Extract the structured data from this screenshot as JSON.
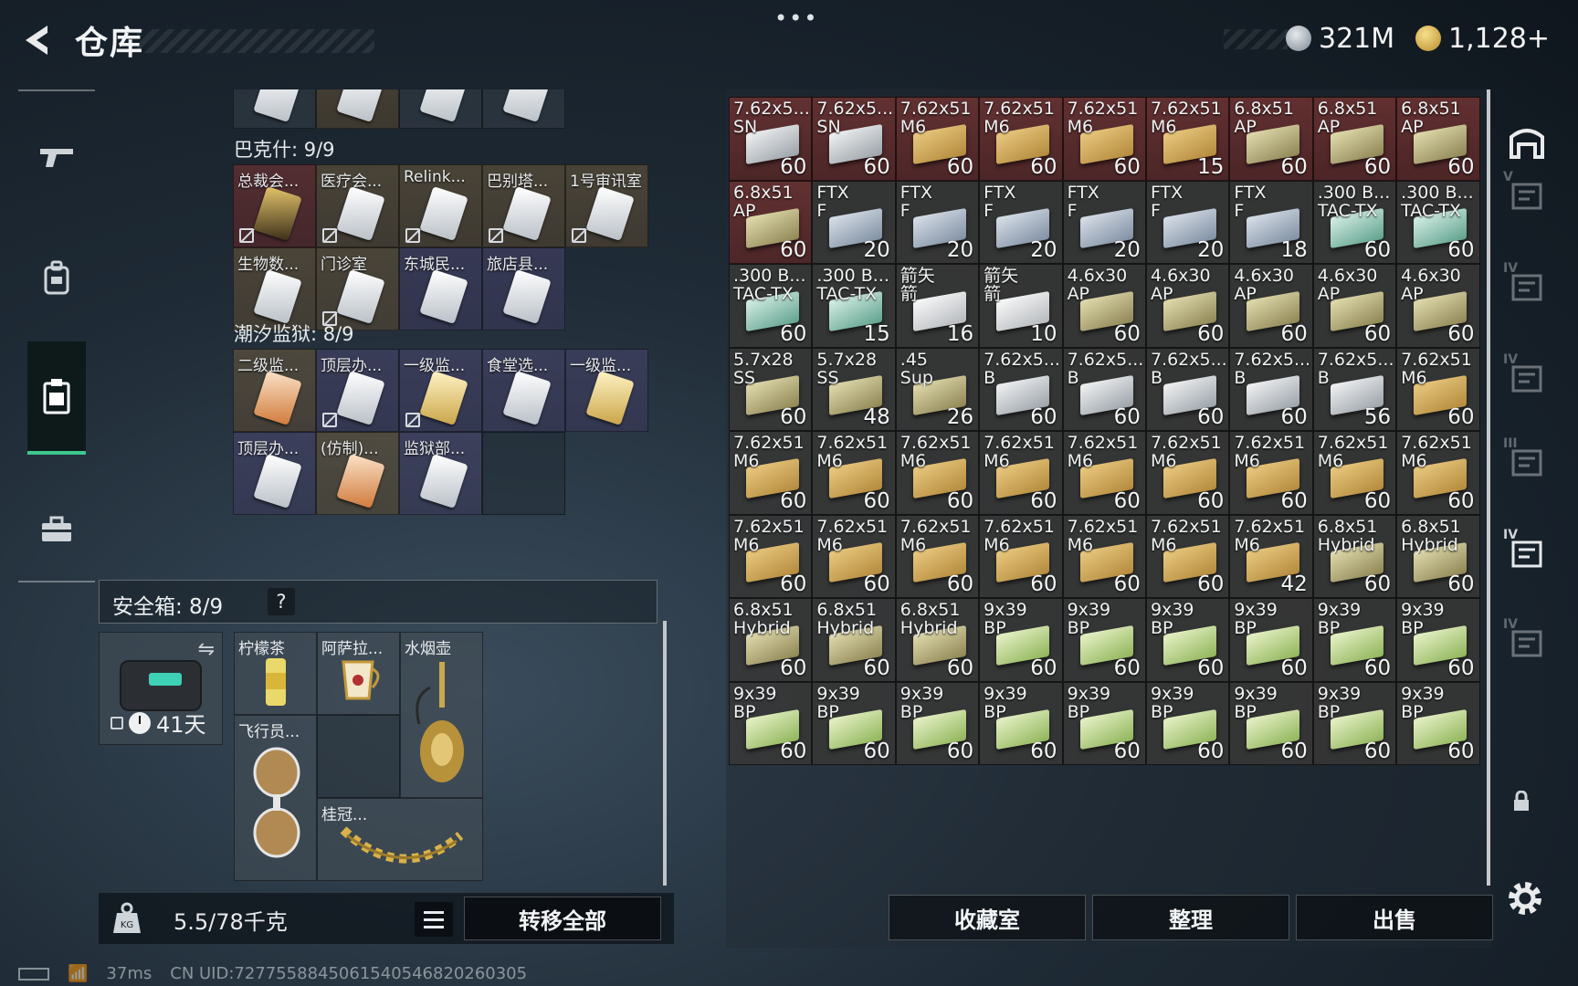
{
  "header": {
    "title": "仓库",
    "currency1": "321M",
    "currency2": "1,128+",
    "more": "•••"
  },
  "left": {
    "sections": [
      {
        "name": "巴克什: 9/9"
      },
      {
        "name": "潮汐监狱: 8/9"
      }
    ],
    "top_partial": [
      "",
      "",
      "",
      ""
    ],
    "bakesh": [
      {
        "label": "总裁会...",
        "style": "red",
        "card": "c-dark",
        "nolink": true
      },
      {
        "label": "医疗会...",
        "style": "gold",
        "card": "",
        "nolink": true
      },
      {
        "label": "Relink...",
        "style": "gold",
        "card": "",
        "nolink": true
      },
      {
        "label": "巴别塔...",
        "style": "gold",
        "card": "",
        "nolink": true
      },
      {
        "label": "1号审讯室",
        "style": "gold",
        "card": "",
        "nolink": true
      },
      {
        "label": "生物数...",
        "style": "gold",
        "card": "",
        "nolink": false
      },
      {
        "label": "门诊室",
        "style": "gold",
        "card": "",
        "nolink": true
      },
      {
        "label": "东城民...",
        "style": "purple",
        "card": "",
        "nolink": false
      },
      {
        "label": "旅店县...",
        "style": "purple",
        "card": "",
        "nolink": false
      }
    ],
    "prison": [
      {
        "label": "二级监...",
        "style": "gold",
        "card": "c-red",
        "nolink": false
      },
      {
        "label": "顶层办...",
        "style": "purple",
        "card": "",
        "nolink": true
      },
      {
        "label": "一级监...",
        "style": "purple",
        "card": "c-gold",
        "nolink": true
      },
      {
        "label": "食堂选...",
        "style": "purple",
        "card": "",
        "nolink": false
      },
      {
        "label": "一级监...",
        "style": "purple",
        "card": "c-gold",
        "nolink": false
      },
      {
        "label": "顶层办...",
        "style": "purple",
        "card": "",
        "nolink": false
      },
      {
        "label": "(仿制)...",
        "style": "gold",
        "card": "c-red",
        "nolink": false
      },
      {
        "label": "监狱部...",
        "style": "purple",
        "card": "",
        "nolink": false
      },
      {
        "label": "",
        "style": "empty",
        "card": "",
        "nolink": false
      }
    ],
    "safe": {
      "title": "安全箱: 8/9",
      "help": "?",
      "timer": "41天",
      "items": [
        {
          "label": "柠檬茶"
        },
        {
          "label": "阿萨拉..."
        },
        {
          "label": "水烟壶"
        },
        {
          "label": "飞行员..."
        },
        {
          "label": "桂冠..."
        }
      ]
    },
    "weight": "5.5/78千克",
    "transfer_label": "转移全部"
  },
  "ammo": [
    {
      "l": "7.62x5...\nSN",
      "c": "60",
      "s": "red",
      "b": "white"
    },
    {
      "l": "7.62x5...\nSN",
      "c": "60",
      "s": "red",
      "b": "white"
    },
    {
      "l": "7.62x51\nM6",
      "c": "60",
      "s": "red",
      "b": "tan"
    },
    {
      "l": "7.62x51\nM6",
      "c": "60",
      "s": "red",
      "b": "tan"
    },
    {
      "l": "7.62x51\nM6",
      "c": "60",
      "s": "red",
      "b": "tan"
    },
    {
      "l": "7.62x51\nM6",
      "c": "15",
      "s": "red",
      "b": "tan"
    },
    {
      "l": "6.8x51\nAP",
      "c": "60",
      "s": "red",
      "b": "olive"
    },
    {
      "l": "6.8x51\nAP",
      "c": "60",
      "s": "red",
      "b": "olive"
    },
    {
      "l": "6.8x51\nAP",
      "c": "60",
      "s": "red",
      "b": "olive"
    },
    {
      "l": "6.8x51\nAP",
      "c": "60",
      "s": "red",
      "b": "olive"
    },
    {
      "l": "FTX\nF",
      "c": "20",
      "s": "",
      "b": "steel"
    },
    {
      "l": "FTX\nF",
      "c": "20",
      "s": "",
      "b": "steel"
    },
    {
      "l": "FTX\nF",
      "c": "20",
      "s": "",
      "b": "steel"
    },
    {
      "l": "FTX\nF",
      "c": "20",
      "s": "",
      "b": "steel"
    },
    {
      "l": "FTX\nF",
      "c": "20",
      "s": "",
      "b": "steel"
    },
    {
      "l": "FTX\nF",
      "c": "18",
      "s": "",
      "b": "steel"
    },
    {
      "l": ".300 B...\nTAC-TX",
      "c": "60",
      "s": "",
      "b": "teal"
    },
    {
      "l": ".300 B...\nTAC-TX",
      "c": "60",
      "s": "",
      "b": "teal"
    },
    {
      "l": ".300 B...\nTAC-TX",
      "c": "60",
      "s": "",
      "b": "teal"
    },
    {
      "l": ".300 B...\nTAC-TX",
      "c": "15",
      "s": "",
      "b": "teal"
    },
    {
      "l": "箭矢\n箭",
      "c": "16",
      "s": "",
      "b": "silver"
    },
    {
      "l": "箭矢\n箭",
      "c": "10",
      "s": "",
      "b": "silver"
    },
    {
      "l": "4.6x30\nAP",
      "c": "60",
      "s": "",
      "b": "olive"
    },
    {
      "l": "4.6x30\nAP",
      "c": "60",
      "s": "",
      "b": "olive"
    },
    {
      "l": "4.6x30\nAP",
      "c": "60",
      "s": "",
      "b": "olive"
    },
    {
      "l": "4.6x30\nAP",
      "c": "60",
      "s": "",
      "b": "olive"
    },
    {
      "l": "4.6x30\nAP",
      "c": "60",
      "s": "",
      "b": "olive"
    },
    {
      "l": "5.7x28\nSS",
      "c": "60",
      "s": "",
      "b": "olive"
    },
    {
      "l": "5.7x28\nSS",
      "c": "48",
      "s": "",
      "b": "olive"
    },
    {
      "l": ".45\nSup",
      "c": "26",
      "s": "",
      "b": "olive"
    },
    {
      "l": "7.62x5...\nB",
      "c": "60",
      "s": "",
      "b": "white"
    },
    {
      "l": "7.62x5...\nB",
      "c": "60",
      "s": "",
      "b": "white"
    },
    {
      "l": "7.62x5...\nB",
      "c": "60",
      "s": "",
      "b": "white"
    },
    {
      "l": "7.62x5...\nB",
      "c": "60",
      "s": "",
      "b": "white"
    },
    {
      "l": "7.62x5...\nB",
      "c": "56",
      "s": "",
      "b": "white"
    },
    {
      "l": "7.62x51\nM6",
      "c": "60",
      "s": "",
      "b": "tan"
    },
    {
      "l": "7.62x51\nM6",
      "c": "60",
      "s": "",
      "b": "tan"
    },
    {
      "l": "7.62x51\nM6",
      "c": "60",
      "s": "",
      "b": "tan"
    },
    {
      "l": "7.62x51\nM6",
      "c": "60",
      "s": "",
      "b": "tan"
    },
    {
      "l": "7.62x51\nM6",
      "c": "60",
      "s": "",
      "b": "tan"
    },
    {
      "l": "7.62x51\nM6",
      "c": "60",
      "s": "",
      "b": "tan"
    },
    {
      "l": "7.62x51\nM6",
      "c": "60",
      "s": "",
      "b": "tan"
    },
    {
      "l": "7.62x51\nM6",
      "c": "60",
      "s": "",
      "b": "tan"
    },
    {
      "l": "7.62x51\nM6",
      "c": "60",
      "s": "",
      "b": "tan"
    },
    {
      "l": "7.62x51\nM6",
      "c": "60",
      "s": "",
      "b": "tan"
    },
    {
      "l": "7.62x51\nM6",
      "c": "60",
      "s": "",
      "b": "tan"
    },
    {
      "l": "7.62x51\nM6",
      "c": "60",
      "s": "",
      "b": "tan"
    },
    {
      "l": "7.62x51\nM6",
      "c": "60",
      "s": "",
      "b": "tan"
    },
    {
      "l": "7.62x51\nM6",
      "c": "60",
      "s": "",
      "b": "tan"
    },
    {
      "l": "7.62x51\nM6",
      "c": "60",
      "s": "",
      "b": "tan"
    },
    {
      "l": "7.62x51\nM6",
      "c": "60",
      "s": "",
      "b": "tan"
    },
    {
      "l": "7.62x51\nM6",
      "c": "42",
      "s": "",
      "b": "tan"
    },
    {
      "l": "6.8x51\nHybrid",
      "c": "60",
      "s": "",
      "b": "olive"
    },
    {
      "l": "6.8x51\nHybrid",
      "c": "60",
      "s": "",
      "b": "olive"
    },
    {
      "l": "6.8x51\nHybrid",
      "c": "60",
      "s": "",
      "b": "olive"
    },
    {
      "l": "6.8x51\nHybrid",
      "c": "60",
      "s": "",
      "b": "olive"
    },
    {
      "l": "6.8x51\nHybrid",
      "c": "60",
      "s": "",
      "b": "olive"
    },
    {
      "l": "9x39\nBP",
      "c": "60",
      "s": "",
      "b": "green"
    },
    {
      "l": "9x39\nBP",
      "c": "60",
      "s": "",
      "b": "green"
    },
    {
      "l": "9x39\nBP",
      "c": "60",
      "s": "",
      "b": "green"
    },
    {
      "l": "9x39\nBP",
      "c": "60",
      "s": "",
      "b": "green"
    },
    {
      "l": "9x39\nBP",
      "c": "60",
      "s": "",
      "b": "green"
    },
    {
      "l": "9x39\nBP",
      "c": "60",
      "s": "",
      "b": "green"
    },
    {
      "l": "9x39\nBP",
      "c": "60",
      "s": "",
      "b": "green"
    },
    {
      "l": "9x39\nBP",
      "c": "60",
      "s": "",
      "b": "green"
    },
    {
      "l": "9x39\nBP",
      "c": "60",
      "s": "",
      "b": "green"
    },
    {
      "l": "9x39\nBP",
      "c": "60",
      "s": "",
      "b": "green"
    },
    {
      "l": "9x39\nBP",
      "c": "60",
      "s": "",
      "b": "green"
    },
    {
      "l": "9x39\nBP",
      "c": "60",
      "s": "",
      "b": "green"
    },
    {
      "l": "9x39\nBP",
      "c": "60",
      "s": "",
      "b": "green"
    },
    {
      "l": "9x39\nBP",
      "c": "60",
      "s": "",
      "b": "green"
    },
    {
      "l": "9x39\nBP",
      "c": "60",
      "s": "",
      "b": "green"
    }
  ],
  "actions": {
    "collection": "收藏室",
    "sort": "整理",
    "sell": "出售"
  },
  "right_nav": [
    {
      "tag": "",
      "dim": false
    },
    {
      "tag": "V",
      "dim": true
    },
    {
      "tag": "IV",
      "dim": true
    },
    {
      "tag": "IV",
      "dim": true
    },
    {
      "tag": "III",
      "dim": true
    },
    {
      "tag": "IV",
      "dim": false
    },
    {
      "tag": "IV",
      "dim": true
    }
  ],
  "footer": {
    "ping": "37ms",
    "uid": "CN UID:7277558845061540546820260305"
  },
  "colors": {
    "accent_green": "#3ec68d",
    "slot_red": "#6e3232",
    "slot_gold": "#6e5a3c"
  }
}
